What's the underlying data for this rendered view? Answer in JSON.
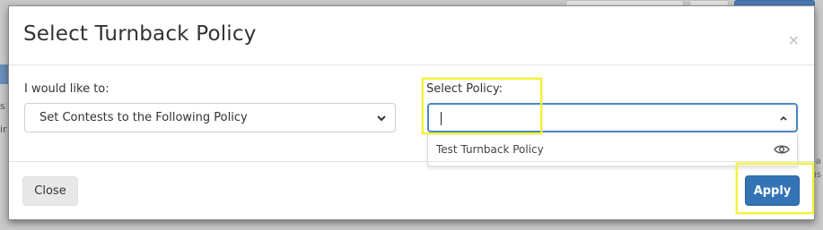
{
  "modal": {
    "title": "Select Turnback Policy",
    "close_symbol": "×"
  },
  "form": {
    "action_label": "I would like to:",
    "action_selected": "Set Contests to the Following Policy",
    "policy_label": "Select Policy:",
    "policy_input_value": "",
    "policy_options": [
      {
        "label": "Test Turnback Policy",
        "icon": "eye-icon"
      }
    ]
  },
  "footer": {
    "close_label": "Close",
    "apply_label": "Apply"
  },
  "background": {
    "left_fragments": [
      "s",
      "ir"
    ],
    "right_fragments": [
      "cia",
      "us"
    ]
  },
  "colors": {
    "primary_button": "#3474b5",
    "focus_border": "#4a86c5",
    "highlight": "#f2f23a"
  }
}
